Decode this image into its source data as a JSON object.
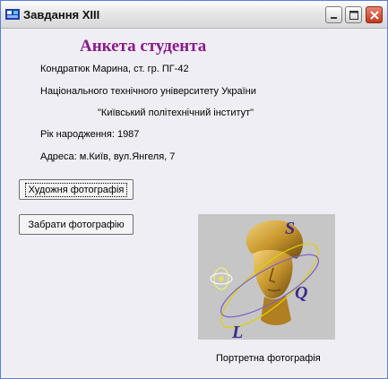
{
  "window": {
    "title": "Завдання XIII",
    "controls": {
      "minimize": "minimize",
      "maximize": "maximize",
      "close": "close"
    }
  },
  "form": {
    "heading": "Анкета студента",
    "name_line": "Кондратюк Марина, ст. гр. ПГ-42",
    "university_line": "Національного технічного університету України",
    "institute_line": "\"Київський політехнічний інститут\"",
    "birth_year_line": "Рік народження: 1987",
    "address_line": "Адреса: м.Київ, вул.Янгеля, 7",
    "artistic_photo_button": "Художня фотографія",
    "remove_photo_button": "Забрати фотографію",
    "photo_caption": "Портретна фотографія",
    "photo_letters": [
      "S",
      "Q",
      "L"
    ]
  },
  "colors": {
    "heading": "#8b1a8b",
    "window_bg": "#eeeef4",
    "photo_bg": "#c6c6c6",
    "statue_gold": "#c9982e"
  }
}
